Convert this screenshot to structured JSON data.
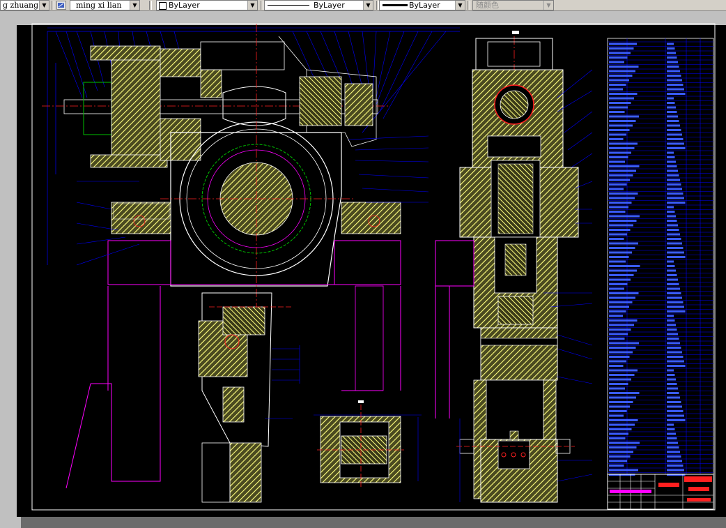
{
  "toolbar": {
    "layer_combo_value": "g zhuang t",
    "layer_combo_arrow": "▼",
    "layer_name_value": "ming xi lian",
    "layer_name_arrow": "▼",
    "color_value": "ByLayer",
    "color_arrow": "▼",
    "linetype_value": "ByLayer",
    "linetype_arrow": "▼",
    "lineweight_value": "ByLayer",
    "lineweight_arrow": "▼",
    "plotstyle_value": "随颜色",
    "plotstyle_arrow": "▼"
  },
  "drawing": {
    "colors": {
      "background": "#000000",
      "frame": "#ffffff",
      "hatch": "#ffff80",
      "dimension": "#0000ff",
      "centerline": "#ff2020",
      "magenta": "#ff00ff",
      "green": "#00c000",
      "table": "#0000ff"
    }
  }
}
